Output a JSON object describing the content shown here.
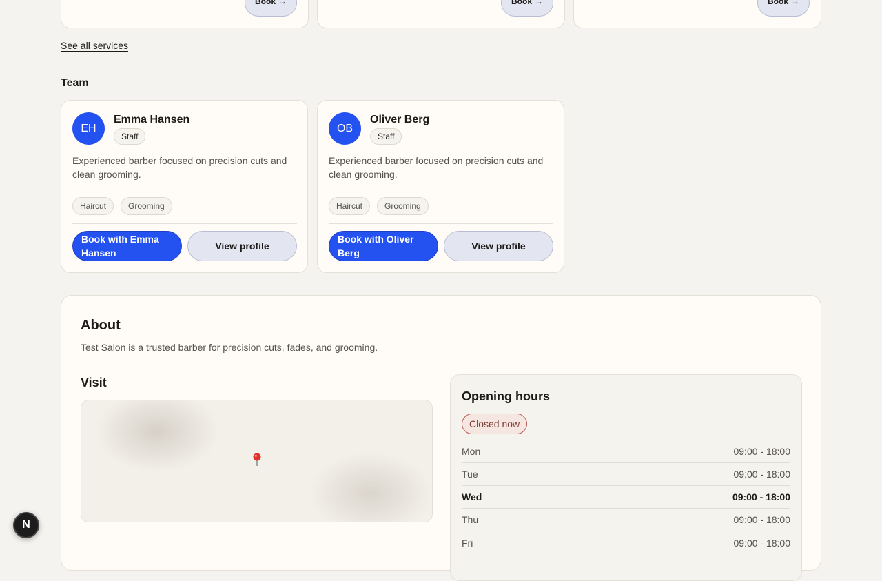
{
  "services": {
    "book_label": "Book",
    "book_arrow": "→",
    "see_all": "See all services"
  },
  "team": {
    "heading": "Team",
    "members": [
      {
        "initials": "EH",
        "name": "Emma Hansen",
        "role": "Staff",
        "bio": "Experienced barber focused on precision cuts and clean grooming.",
        "tags": [
          "Haircut",
          "Grooming"
        ],
        "book_label": "Book with Emma Hansen",
        "profile_label": "View profile"
      },
      {
        "initials": "OB",
        "name": "Oliver Berg",
        "role": "Staff",
        "bio": "Experienced barber focused on precision cuts and clean grooming.",
        "tags": [
          "Haircut",
          "Grooming"
        ],
        "book_label": "Book with Oliver Berg",
        "profile_label": "View profile"
      }
    ]
  },
  "about": {
    "title": "About",
    "text": "Test Salon is a trusted barber for precision cuts, fades, and grooming."
  },
  "visit": {
    "title": "Visit"
  },
  "hours": {
    "title": "Opening hours",
    "status": "Closed now",
    "days": [
      {
        "day": "Mon",
        "time": "09:00 - 18:00"
      },
      {
        "day": "Tue",
        "time": "09:00 - 18:00"
      },
      {
        "day": "Wed",
        "time": "09:00 - 18:00"
      },
      {
        "day": "Thu",
        "time": "09:00 - 18:00"
      },
      {
        "day": "Fri",
        "time": "09:00 - 18:00"
      }
    ]
  },
  "dev_badge": "N",
  "colors": {
    "accent": "#2452f0",
    "background": "#f5f3ef",
    "card": "#fffcf7",
    "closed_status": "#b85a52"
  }
}
